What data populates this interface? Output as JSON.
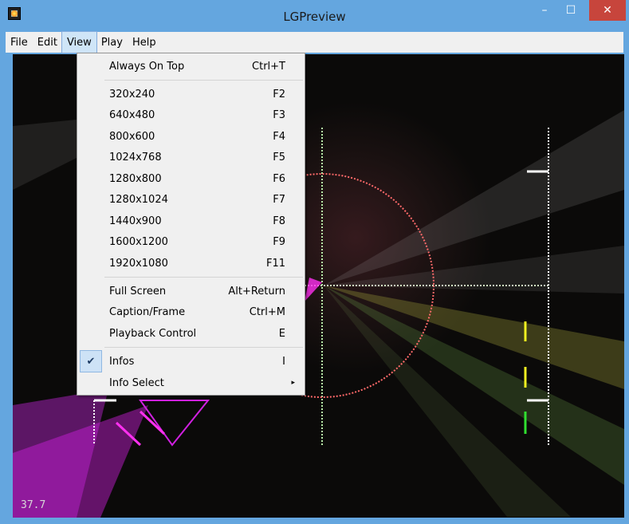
{
  "window": {
    "title": "LGPreview"
  },
  "controls": {
    "minimize": "–",
    "maximize": "☐",
    "close": "✕"
  },
  "menubar": [
    "File",
    "Edit",
    "View",
    "Play",
    "Help"
  ],
  "active_menu": "View",
  "view_menu": {
    "always_on_top": {
      "label": "Always On Top",
      "shortcut": "Ctrl+T"
    },
    "resolutions": [
      {
        "label": "320x240",
        "shortcut": "F2"
      },
      {
        "label": "640x480",
        "shortcut": "F3"
      },
      {
        "label": "800x600",
        "shortcut": "F4"
      },
      {
        "label": "1024x768",
        "shortcut": "F5"
      },
      {
        "label": "1280x800",
        "shortcut": "F6"
      },
      {
        "label": "1280x1024",
        "shortcut": "F7"
      },
      {
        "label": "1440x900",
        "shortcut": "F8"
      },
      {
        "label": "1600x1200",
        "shortcut": "F9"
      },
      {
        "label": "1920x1080",
        "shortcut": "F11"
      }
    ],
    "full_screen": {
      "label": "Full Screen",
      "shortcut": "Alt+Return"
    },
    "caption_frame": {
      "label": "Caption/Frame",
      "shortcut": "Ctrl+M"
    },
    "playback_control": {
      "label": "Playback Control",
      "shortcut": "E"
    },
    "infos": {
      "label": "Infos",
      "shortcut": "I",
      "checked": true
    },
    "info_select": {
      "label": "Info Select",
      "submenu_arrow": "▸"
    },
    "check_glyph": "✔"
  },
  "preview": {
    "fps": "37.7"
  },
  "colors": {
    "accent": "#64a6df",
    "close": "#c7453c",
    "canvas": "#0b0a09",
    "menu_highlight": "#cfe5f7"
  }
}
